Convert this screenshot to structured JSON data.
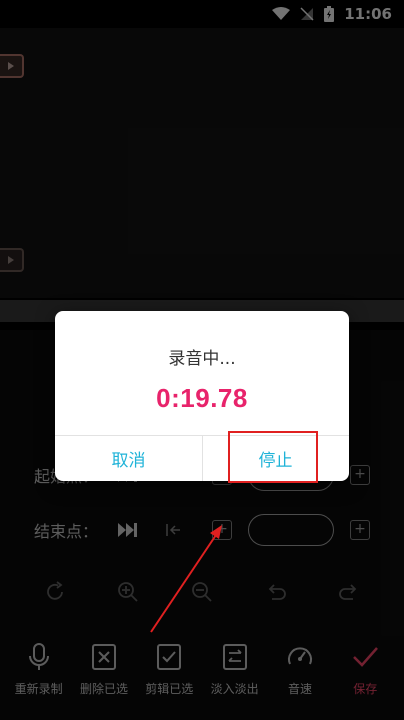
{
  "status_bar": {
    "time": "11:06"
  },
  "editor": {
    "start_label": "起始点：",
    "end_label": "结束点："
  },
  "dialog": {
    "title": "录音中...",
    "timer": "0:19.78",
    "cancel_label": "取消",
    "stop_label": "停止"
  },
  "bottom_bar": {
    "items": [
      {
        "label": "重新录制",
        "icon": "microphone-icon"
      },
      {
        "label": "删除已选",
        "icon": "delete-box-icon"
      },
      {
        "label": "剪辑已选",
        "icon": "check-box-icon"
      },
      {
        "label": "淡入淡出",
        "icon": "fade-icon"
      },
      {
        "label": "音速",
        "icon": "speedometer-icon"
      },
      {
        "label": "保存",
        "icon": "checkmark-icon"
      }
    ]
  },
  "colors": {
    "accent": "#e8236b",
    "dialog_button": "#1fb3d8",
    "save": "#ff4a6e",
    "annotation": "#e02020"
  }
}
